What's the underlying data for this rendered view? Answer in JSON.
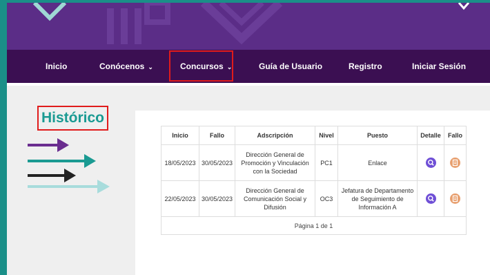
{
  "nav": {
    "items": [
      {
        "label": "Inicio"
      },
      {
        "label": "Conócenos",
        "chevron": "⌄"
      },
      {
        "label": "Concursos",
        "chevron": "⌄"
      },
      {
        "label": "Guía de Usuario"
      },
      {
        "label": "Registro"
      },
      {
        "label": "Iniciar Sesión"
      }
    ]
  },
  "page": {
    "title": "Histórico"
  },
  "table": {
    "headers": [
      "Inicio",
      "Fallo",
      "Adscripción",
      "Nivel",
      "Puesto",
      "Detalle",
      "Fallo"
    ],
    "rows": [
      {
        "inicio": "18/05/2023",
        "fallo": "30/05/2023",
        "adscripcion": "Dirección General de Promoción y Vinculación con la Sociedad",
        "nivel": "PC1",
        "puesto": "Enlace"
      },
      {
        "inicio": "22/05/2023",
        "fallo": "30/05/2023",
        "adscripcion": "Dirección General de Comunicación Social y Difusión",
        "nivel": "OC3",
        "puesto": "Jefatura de Departamento de Seguimiento de Información A"
      }
    ],
    "pagination": "Página 1 de 1"
  },
  "colors": {
    "banner": "#5b2d87",
    "nav": "#3b0f52",
    "accent_teal": "#1a9a92",
    "highlight_red": "#e01b1b",
    "detail_icon": "#6f4fd6",
    "fallo_icon": "#e8a070"
  },
  "icons": {
    "detail": "search-icon",
    "fallo": "document-icon"
  }
}
